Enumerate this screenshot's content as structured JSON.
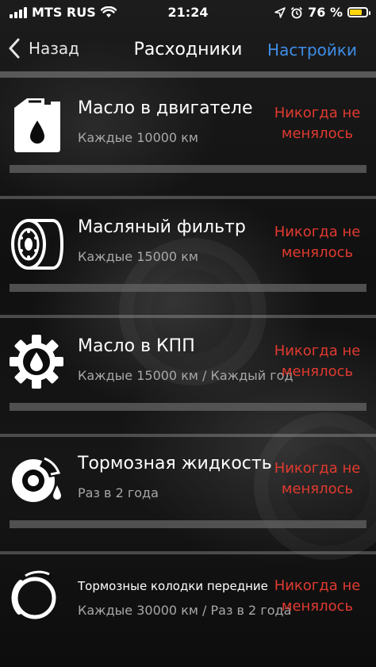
{
  "status_bar": {
    "carrier": "MTS RUS",
    "time": "21:24",
    "battery_text": "76 %",
    "battery_level": 0.76
  },
  "nav": {
    "back_label": "Назад",
    "title": "Расходники",
    "settings_label": "Настройки"
  },
  "items": [
    {
      "title": "Масло в двигателе",
      "subtitle": "Каждые 10000 км",
      "status": "Никогда не менялось",
      "icon": "oil-canister-icon",
      "progress": 0
    },
    {
      "title": "Масляный фильтр",
      "subtitle": "Каждые 15000 км",
      "status": "Никогда не менялось",
      "icon": "oil-filter-icon",
      "progress": 0
    },
    {
      "title": "Масло в КПП",
      "subtitle": "Каждые 15000 км / Каждый год",
      "status": "Никогда не менялось",
      "icon": "gear-oil-icon",
      "progress": 0
    },
    {
      "title": "Тормозная жидкость",
      "subtitle": "Раз в 2 года",
      "status": "Никогда не менялось",
      "icon": "brake-fluid-icon",
      "progress": 0
    },
    {
      "title": "Тормозные колодки передние",
      "subtitle": "Каждые 30000 км / Раз в 2 года",
      "status": "Никогда не менялось",
      "icon": "brake-pads-icon",
      "progress": 0
    }
  ],
  "colors": {
    "accent": "#3f8ee8",
    "status_red": "#e03a2f"
  }
}
